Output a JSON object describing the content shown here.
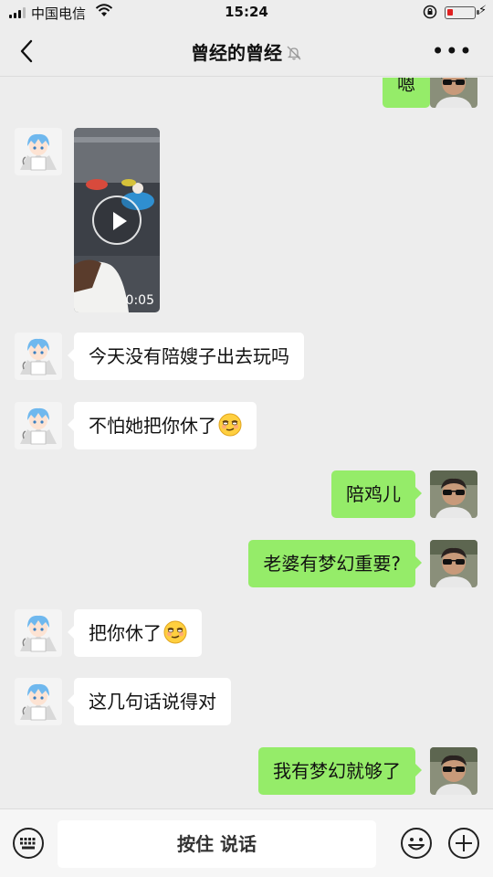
{
  "status_bar": {
    "carrier": "中国电信",
    "time": "15:24",
    "battery_level": 0.22
  },
  "header": {
    "title": "曾经的曾经"
  },
  "chat": {
    "partial_message": "嗯",
    "video": {
      "duration": "0:05"
    },
    "messages": [
      {
        "side": "in",
        "text": "今天没有陪嫂子出去玩吗"
      },
      {
        "side": "in",
        "text": "不怕她把你休了",
        "emoji": "smirk-emoji"
      },
      {
        "side": "out",
        "text": "陪鸡儿"
      },
      {
        "side": "out",
        "text": "老婆有梦幻重要?"
      },
      {
        "side": "in",
        "text": "把你休了",
        "emoji": "smirk-emoji"
      },
      {
        "side": "in",
        "text": "这几句话说得对"
      },
      {
        "side": "out",
        "text": "我有梦幻就够了"
      }
    ]
  },
  "input_bar": {
    "voice_label": "按住 说话"
  },
  "colors": {
    "outgoing_bubble": "#95ec69",
    "incoming_bubble": "#ffffff",
    "background": "#ededed"
  }
}
